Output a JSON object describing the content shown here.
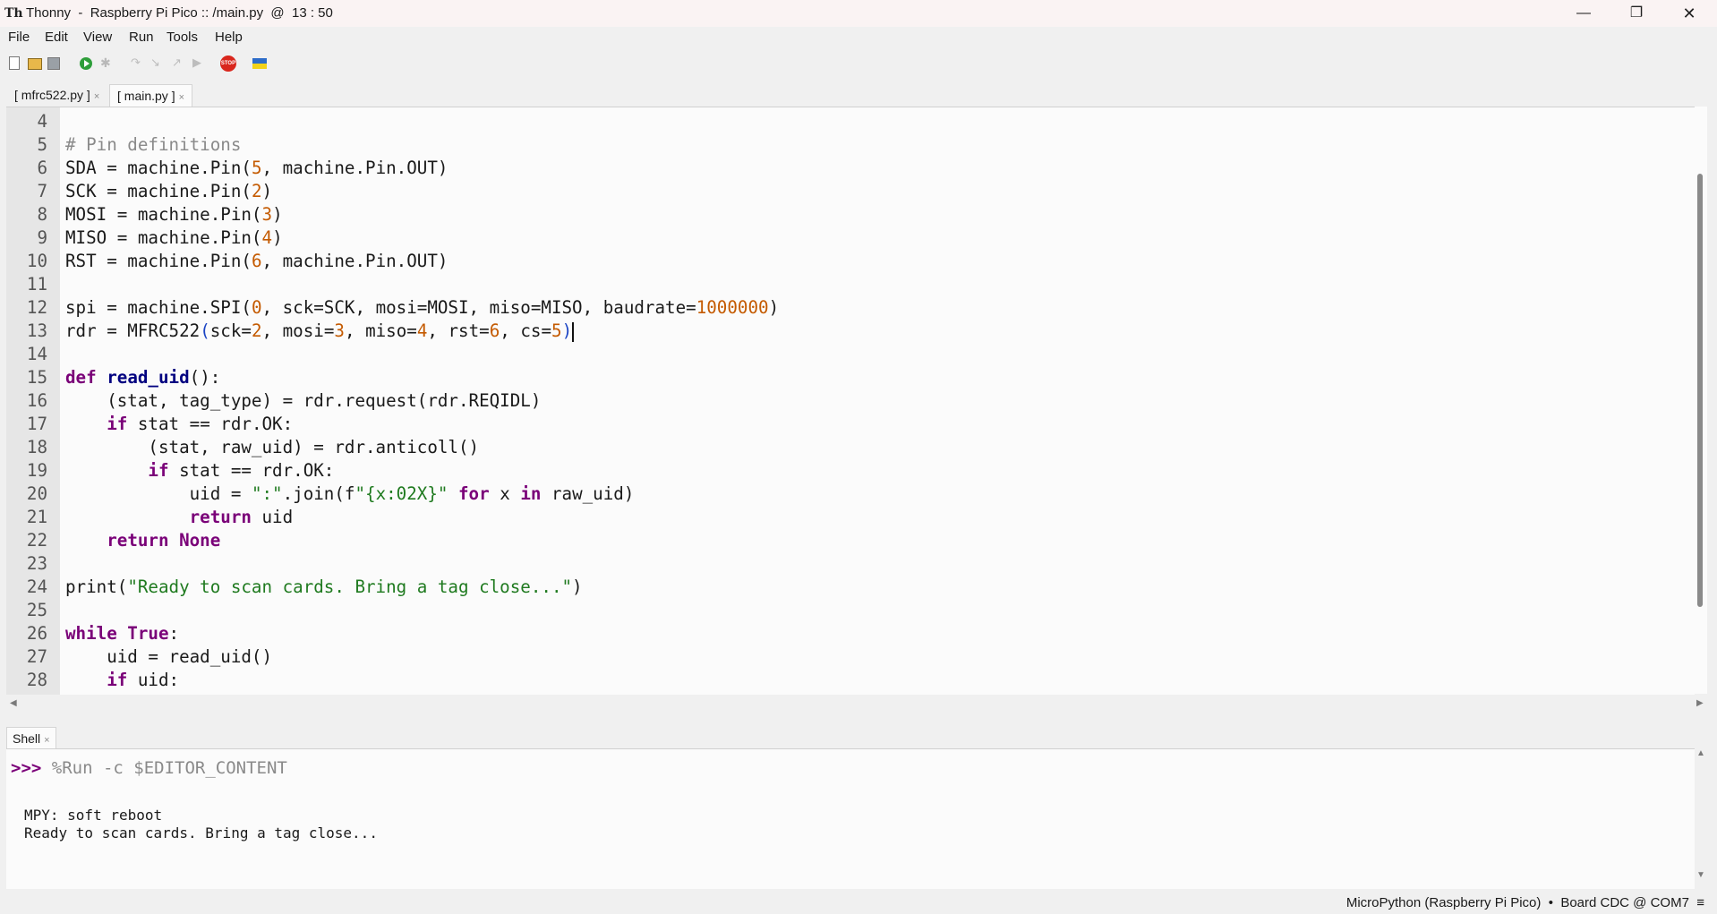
{
  "window": {
    "title": "Thonny  -  Raspberry Pi Pico :: /main.py  @  13 : 50",
    "app_icon": "thonny-logo-icon",
    "minimize": "—",
    "maximize": "❐",
    "close": "✕"
  },
  "menu": [
    "File",
    "Edit",
    "View",
    "Run",
    "Tools",
    "Help"
  ],
  "toolbar": {
    "icons": [
      "new-file-icon",
      "open-file-icon",
      "save-icon",
      "run-icon",
      "debug-icon",
      "step-over-icon",
      "step-into-icon",
      "step-out-icon",
      "resume-icon",
      "stop-icon",
      "ukraine-flag-icon"
    ],
    "stop_label": "STOP"
  },
  "tabs": [
    {
      "label": "[ mfrc522.py ]",
      "close": "×",
      "active": false
    },
    {
      "label": "[ main.py ]",
      "close": "×",
      "active": true
    }
  ],
  "editor": {
    "lines": [
      {
        "n": "4"
      },
      {
        "n": "5"
      },
      {
        "n": "6"
      },
      {
        "n": "7"
      },
      {
        "n": "8"
      },
      {
        "n": "9"
      },
      {
        "n": "10"
      },
      {
        "n": "11"
      },
      {
        "n": "12"
      },
      {
        "n": "13"
      },
      {
        "n": "14"
      },
      {
        "n": "15"
      },
      {
        "n": "16"
      },
      {
        "n": "17"
      },
      {
        "n": "18"
      },
      {
        "n": "19"
      },
      {
        "n": "20"
      },
      {
        "n": "21"
      },
      {
        "n": "22"
      },
      {
        "n": "23"
      },
      {
        "n": "24"
      },
      {
        "n": "25"
      },
      {
        "n": "26"
      },
      {
        "n": "27"
      },
      {
        "n": "28"
      }
    ],
    "code": {
      "l5": "# Pin definitions",
      "l6a": "SDA = machine.Pin(",
      "l6n": "5",
      "l6b": ", machine.Pin.OUT)",
      "l7a": "SCK = machine.Pin(",
      "l7n": "2",
      "l7b": ")",
      "l8a": "MOSI = machine.Pin(",
      "l8n": "3",
      "l8b": ")",
      "l9a": "MISO = machine.Pin(",
      "l9n": "4",
      "l9b": ")",
      "l10a": "RST = machine.Pin(",
      "l10n": "6",
      "l10b": ", machine.Pin.OUT)",
      "l12a": "spi = machine.SPI(",
      "l12n1": "0",
      "l12b": ", sck=SCK, mosi=MOSI, miso=MISO, baudrate=",
      "l12n2": "1000000",
      "l12c": ")",
      "l13a": "rdr = MFRC522",
      "l13p": "(",
      "l13b": "sck=",
      "l13n1": "2",
      "l13c": ", mosi=",
      "l13n2": "3",
      "l13d": ", miso=",
      "l13n3": "4",
      "l13e": ", rst=",
      "l13n4": "6",
      "l13f": ", cs=",
      "l13n5": "5",
      "l13q": ")",
      "l15k": "def",
      "l15f": "read_uid",
      "l15r": "():",
      "l16": "    (stat, tag_type) = rdr.request(rdr.REQIDL)",
      "l17i": "    ",
      "l17k": "if",
      "l17r": " stat == rdr.OK:",
      "l18": "        (stat, raw_uid) = rdr.anticoll()",
      "l19i": "        ",
      "l19k": "if",
      "l19r": " stat == rdr.OK:",
      "l20a": "            uid = ",
      "l20s1": "\":\"",
      "l20b": ".join(f",
      "l20s2": "\"{x:02X}\"",
      "l20c": " ",
      "l20k1": "for",
      "l20d": " x ",
      "l20k2": "in",
      "l20e": " raw_uid)",
      "l21i": "            ",
      "l21k": "return",
      "l21r": " uid",
      "l22i": "    ",
      "l22k": "return None",
      "l24a": "print(",
      "l24s": "\"Ready to scan cards. Bring a tag close...\"",
      "l24b": ")",
      "l26k": "while True",
      "l26r": ":",
      "l27": "    uid = read_uid()",
      "l28i": "    ",
      "l28k": "if",
      "l28r": " uid:"
    }
  },
  "shell": {
    "tab_label": "Shell",
    "tab_close": "×",
    "prompt": ">>> ",
    "command": "%Run -c $EDITOR_CONTENT",
    "output": [
      "MPY: soft reboot",
      "Ready to scan cards. Bring a tag close..."
    ]
  },
  "status": {
    "text": "MicroPython (Raspberry Pi Pico)  •  Board CDC @ COM7  ≡"
  }
}
